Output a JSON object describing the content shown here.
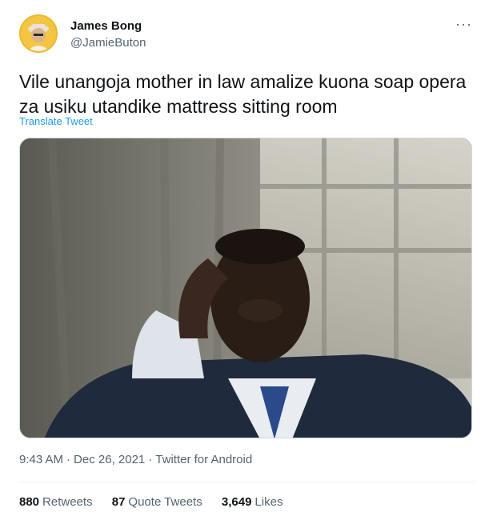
{
  "user": {
    "name": "James Bong",
    "handle": "@JamieButon"
  },
  "tweet": {
    "text": "Vile unangoja mother in law amalize kuona soap opera za usiku utandike mattress sitting room",
    "translate_label": "Translate Tweet",
    "time": "9:43 AM",
    "date": "Dec 26, 2021",
    "source": "Twitter for Android",
    "separator": "·"
  },
  "stats": {
    "retweets": {
      "count": "880",
      "label": "Retweets"
    },
    "quote_tweets": {
      "count": "87",
      "label": "Quote Tweets"
    },
    "likes": {
      "count": "3,649",
      "label": "Likes"
    }
  },
  "icons": {
    "more": "more-options-icon"
  },
  "colors": {
    "link": "#1d9bf0",
    "secondary_text": "#536471",
    "primary_text": "#0f1419",
    "avatar_bg": "#f4c542"
  }
}
